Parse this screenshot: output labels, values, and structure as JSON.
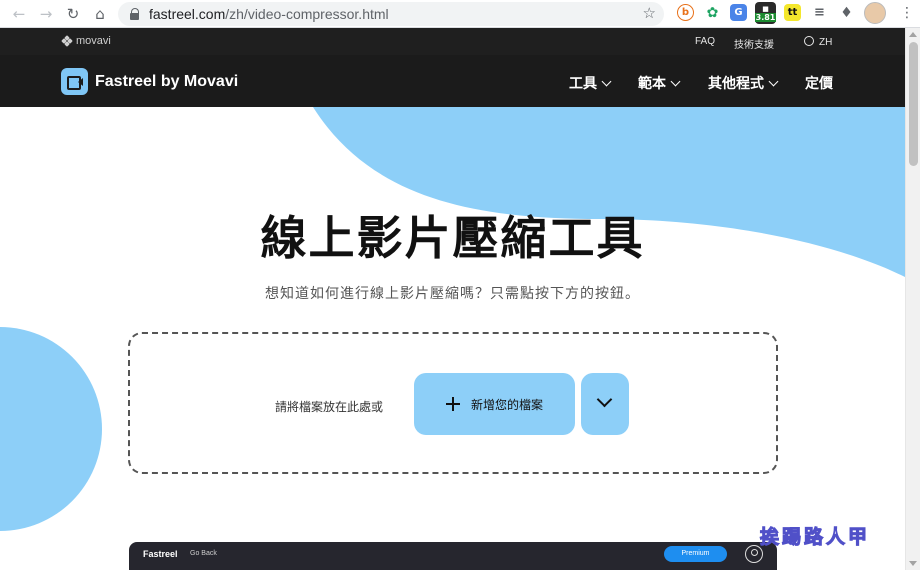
{
  "browser": {
    "url_host": "fastreel.com",
    "url_path": "/zh/video-compressor.html",
    "extension_badge": "3.81"
  },
  "site_topbar": {
    "logo": "movavi",
    "faq": "FAQ",
    "support": "技術支援",
    "lang": "ZH"
  },
  "nav": {
    "brand": "Fastreel by Movavi",
    "items": [
      "工具",
      "範本",
      "其他程式",
      "定價"
    ]
  },
  "hero": {
    "title": "線上影片壓縮工具",
    "subtitle": "想知道如何進行線上影片壓縮嗎？只需點按下方的按鈕。",
    "drop_text": "請將檔案放在此處或",
    "add_button": "新增您的檔案"
  },
  "preview_bar": {
    "brand": "Fastreel",
    "back": "Go Back",
    "premium": "Premium"
  },
  "watermark": "挨踢路人甲",
  "colors": {
    "accent": "#8dcff8",
    "nav_bg": "#1b1b1b"
  }
}
